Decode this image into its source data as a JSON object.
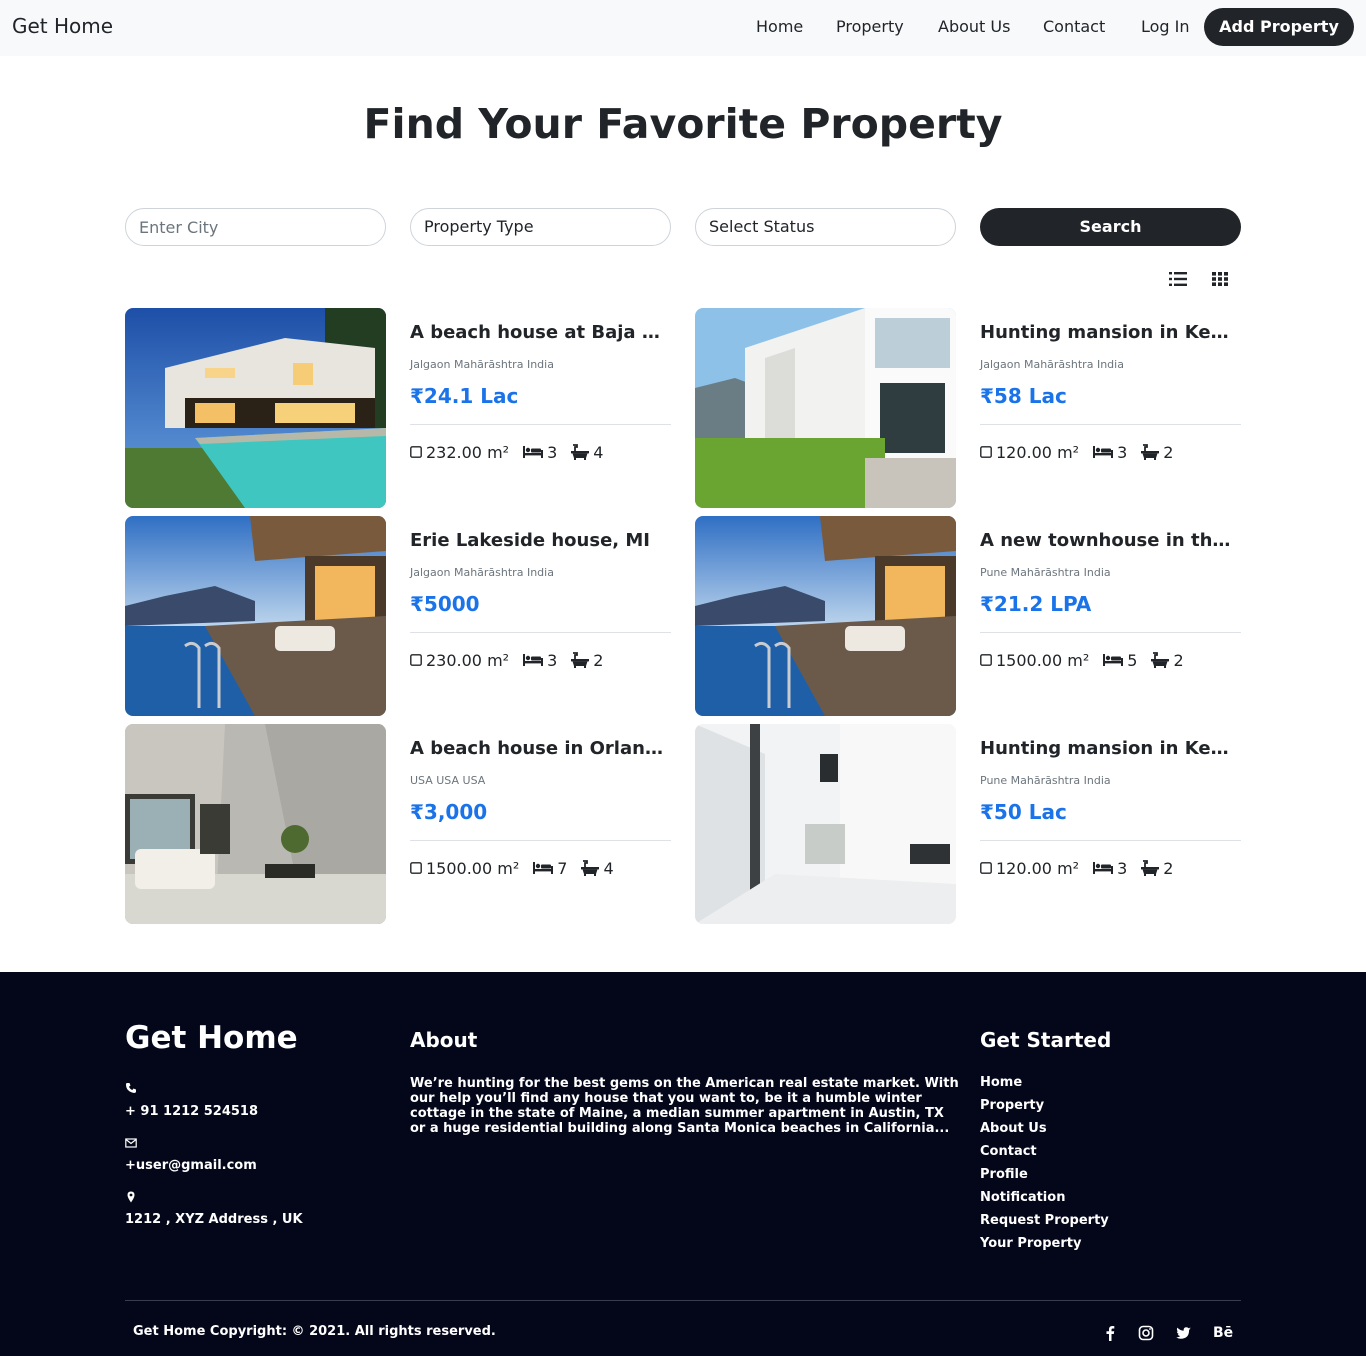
{
  "navbar": {
    "brand": "Get Home",
    "links": [
      "Home",
      "Property",
      "About Us",
      "Contact",
      "Log In"
    ],
    "add_property": "Add Property"
  },
  "hero": {
    "title": "Find Your Favorite Property"
  },
  "search": {
    "city_placeholder": "Enter City",
    "property_type": "Property Type",
    "status": "Select Status",
    "button": "Search"
  },
  "view_toggle": {
    "list_icon": "list-view-icon",
    "grid_icon": "grid-view-icon"
  },
  "listings": [
    {
      "title": "A beach house at Baja Cali...",
      "location": "Jalgaon Mahārāshtra India",
      "price": "₹24.1 Lac",
      "area": "232.00 m²",
      "beds": "3",
      "baths": "4"
    },
    {
      "title": "Hunting mansion in Kentuc...",
      "location": "Jalgaon Mahārāshtra India",
      "price": "₹58 Lac",
      "area": "120.00 m²",
      "beds": "3",
      "baths": "2"
    },
    {
      "title": "Erie Lakeside house, MI",
      "location": "Jalgaon Mahārāshtra India",
      "price": "₹5000",
      "area": "230.00 m²",
      "beds": "3",
      "baths": "2"
    },
    {
      "title": "A new townhouse in the Ap...",
      "location": "Pune Mahārāshtra India",
      "price": "₹21.2 LPA",
      "area": "1500.00 m²",
      "beds": "5",
      "baths": "2"
    },
    {
      "title": "A beach house in Orlando, ...",
      "location": "USA USA USA",
      "price": "₹3,000",
      "area": "1500.00 m²",
      "beds": "7",
      "baths": "4"
    },
    {
      "title": "Hunting mansion in Kentuc...",
      "location": "Pune Mahārāshtra India",
      "price": "₹50 Lac",
      "area": "120.00 m²",
      "beds": "3",
      "baths": "2"
    }
  ],
  "footer": {
    "brand": "Get Home",
    "phone": "+ 91 1212 524518",
    "email": "+user@gmail.com",
    "address": "1212 , XYZ Address , UK",
    "about_heading": "About",
    "about_text": "We’re hunting for the best gems on the American real estate market. With our help you’ll find any house that you want to, be it a humble winter cottage in the state of Maine, a median summer apartment in Austin, TX or a huge residential building along Santa Monica beaches in California...",
    "started_heading": "Get Started",
    "links": [
      "Home",
      "Property",
      "About Us",
      "Contact",
      "Profile",
      "Notification",
      "Request Property",
      "Your Property"
    ],
    "copyright": "Get Home Copyright: © 2021. All rights reserved.",
    "social": {
      "behance": "Bē"
    }
  },
  "colors": {
    "dark": "#212529",
    "price": "#1a73e8",
    "footer_bg": "#04061a",
    "nav_bg": "#f8f9fa"
  }
}
